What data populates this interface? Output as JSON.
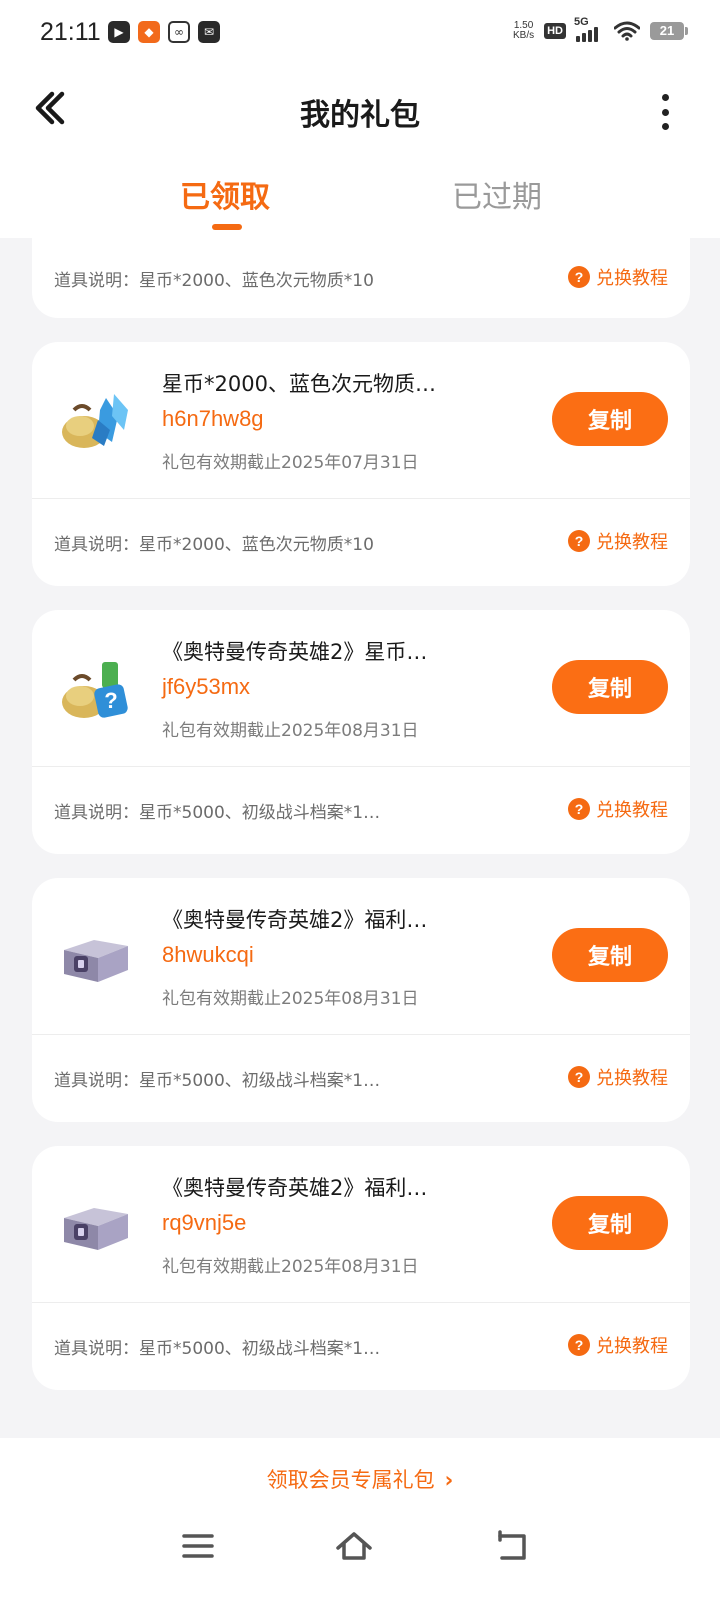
{
  "status_bar": {
    "time": "21:11",
    "net_speed_value": "1.50",
    "net_speed_unit": "KB/s",
    "hd": "HD",
    "network": "5G",
    "battery": "21"
  },
  "header": {
    "title": "我的礼包"
  },
  "tabs": [
    {
      "label": "已领取",
      "active": true
    },
    {
      "label": "已过期",
      "active": false
    }
  ],
  "partial_card": {
    "description": "道具说明：星币*2000、蓝色次元物质*10",
    "tutorial_label": "兑换教程"
  },
  "gifts": [
    {
      "icon": "crystal-gift-icon",
      "name": "星币*2000、蓝色次元物质…",
      "code": "h6n7hw8g",
      "expiry": "礼包有效期截止2025年07月31日",
      "copy_label": "复制",
      "description": "道具说明：星币*2000、蓝色次元物质*10",
      "tutorial_label": "兑换教程"
    },
    {
      "icon": "mystery-gift-icon",
      "name": "《奥特曼传奇英雄2》星币…",
      "code": "jf6y53mx",
      "expiry": "礼包有效期截止2025年08月31日",
      "copy_label": "复制",
      "description": "道具说明：星币*5000、初级战斗档案*1…",
      "tutorial_label": "兑换教程"
    },
    {
      "icon": "treasure-chest-icon",
      "name": "《奥特曼传奇英雄2》福利…",
      "code": "8hwukcqi",
      "expiry": "礼包有效期截止2025年08月31日",
      "copy_label": "复制",
      "description": "道具说明：星币*5000、初级战斗档案*1…",
      "tutorial_label": "兑换教程"
    },
    {
      "icon": "treasure-chest-icon",
      "name": "《奥特曼传奇英雄2》福利…",
      "code": "rq9vnj5e",
      "expiry": "礼包有效期截止2025年08月31日",
      "copy_label": "复制",
      "description": "道具说明：星币*5000、初级战斗档案*1…",
      "tutorial_label": "兑换教程"
    }
  ],
  "bottom": {
    "member_link": "领取会员专属礼包"
  },
  "colors": {
    "accent": "#f56a12",
    "button": "#fb6e14",
    "background": "#f4f4f6"
  }
}
